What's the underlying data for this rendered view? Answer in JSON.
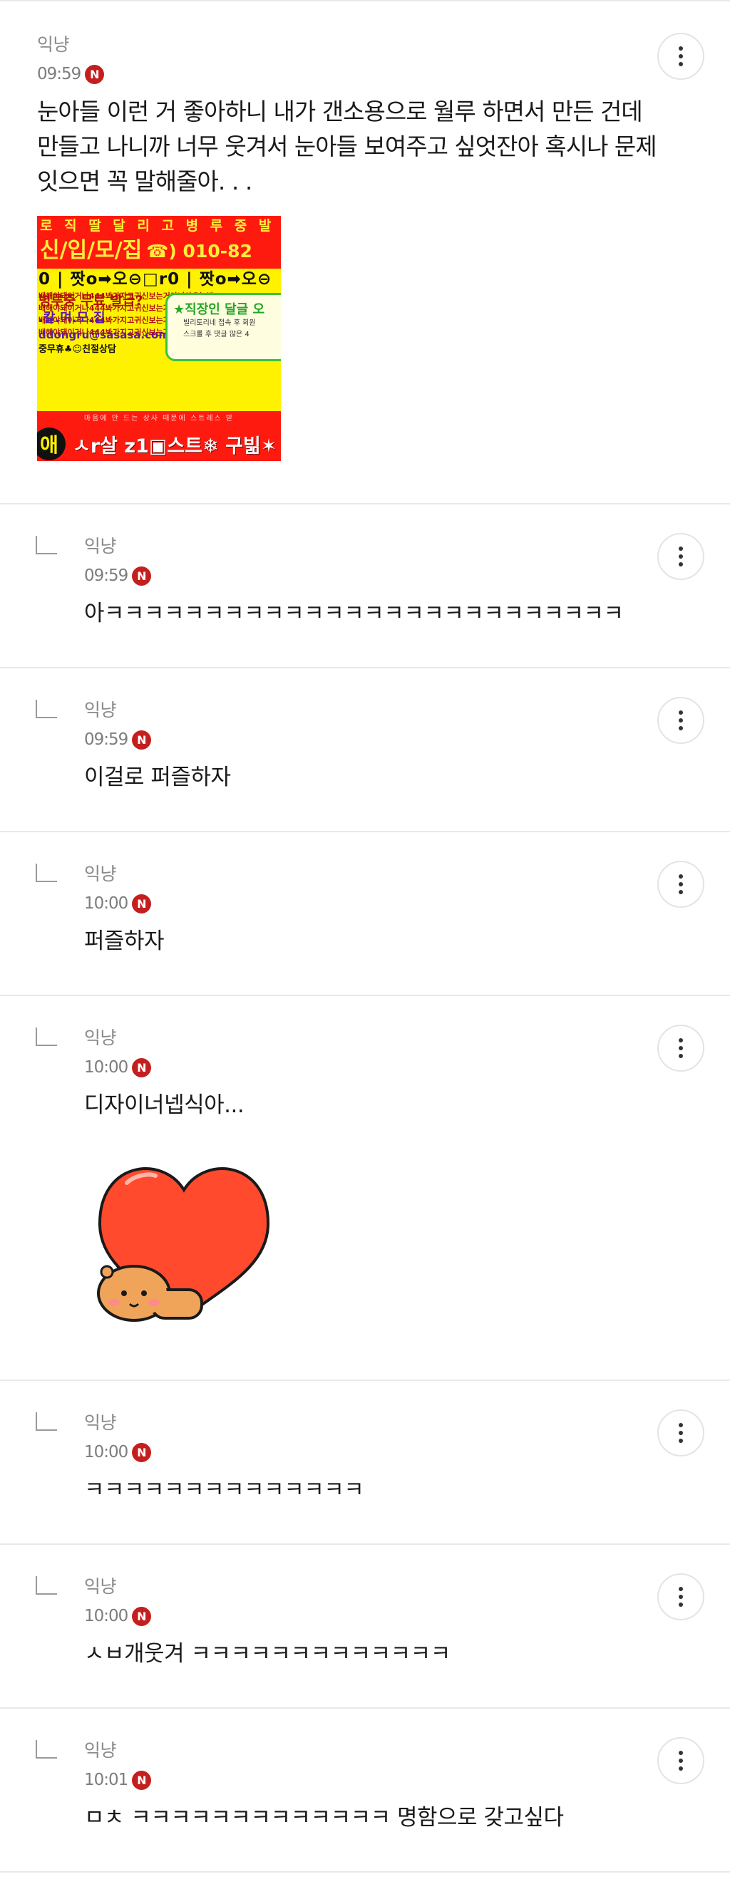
{
  "post": {
    "author": "익냥",
    "time": "09:59",
    "badge": "N",
    "body": "눈아들 이런 거 좋아하니 내가 갠소용으로 월루 하면서 만든 건데\n만들고 나니까 너무 웃겨서 눈아들 보여주고 싶엇잔아 혹시나 문제\n잇으면 꼭 말해줄아. . .",
    "image": {
      "top_line": "로 직 딸 달 리 고 병 루 중 발",
      "recruit": "신/입/모/집",
      "phone": "☎) 010-82",
      "row1": "0 | 짯o➡오⊖□r0 | 짯o➡오⊖",
      "lines": [
        "배해야돼이거나444봐가지고귀신보는거아니야오늘밤",
        "배해야돼이거나444봐가지고귀신보는거아니야오늘밤",
        "배해야돼이거나444봐가지고귀신보는거아니야오늘밤",
        "배해야돼이거나444봐가지고귀신보는거아니야오늘밤"
      ],
      "free": "병루중 무료 발급?",
      "dots": ".칼.며.모.집",
      "email": "ddongru@sasasa.com",
      "consult": "중무휴♣☺친절상담",
      "green_title": "★직장인 달글 오",
      "green_line1": "빌리토리네 접속 후 회원",
      "green_line2": "스크롤 후 댓글 많은 4",
      "bottom_small": "마음에 안 드는 상사 때문에 스트레스 받",
      "bottom_circle": "애",
      "bottom_text": "ㅅr살 z1▣스트❄ 구빎✶"
    }
  },
  "comments": [
    {
      "author": "익냥",
      "time": "09:59",
      "badge": "N",
      "body": "아ㅋㅋㅋㅋㅋㅋㅋㅋㅋㅋㅋㅋㅋㅋㅋㅋㅋㅋㅋㅋㅋㅋㅋㅋㅋㅋ"
    },
    {
      "author": "익냥",
      "time": "09:59",
      "badge": "N",
      "body": "이걸로 퍼즐하자"
    },
    {
      "author": "익냥",
      "time": "10:00",
      "badge": "N",
      "body": "퍼즐하자"
    },
    {
      "author": "익냥",
      "time": "10:00",
      "badge": "N",
      "body": "디자이너넵식아..."
    },
    {
      "author": "익냥",
      "time": "10:00",
      "badge": "N",
      "body": "ㅋㅋㅋㅋㅋㅋㅋㅋㅋㅋㅋㅋㅋㅋ"
    },
    {
      "author": "익냥",
      "time": "10:00",
      "badge": "N",
      "body": "ㅅㅂ개웃겨 ㅋㅋㅋㅋㅋㅋㅋㅋㅋㅋㅋㅋㅋ"
    },
    {
      "author": "익냥",
      "time": "10:01",
      "badge": "N",
      "body": "ㅁㅊ ㅋㅋㅋㅋㅋㅋㅋㅋㅋㅋㅋㅋㅋ 명함으로 갖고싶다"
    }
  ],
  "colors": {
    "badge": "#c41e1e",
    "divider": "#e9e9e9",
    "ad_red": "#ff1a10",
    "ad_yellow": "#fff200"
  },
  "icons": {
    "more": "more-vertical-icon",
    "reply": "reply-arrow-icon",
    "new": "new-badge"
  }
}
